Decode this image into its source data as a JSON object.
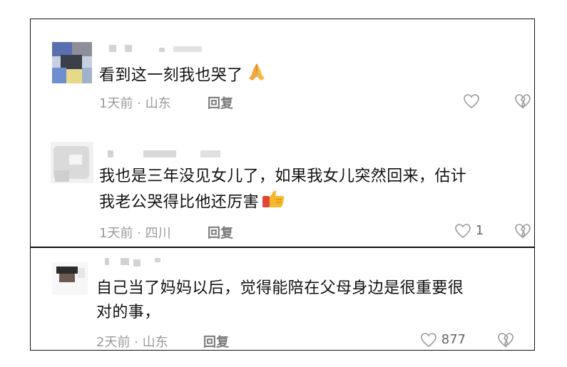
{
  "comments": [
    {
      "text": "看到这一刻我也哭了",
      "emoji": "praying-hands-icon",
      "time_location": "1天前 · 山东",
      "reply_label": "回复",
      "like_count": ""
    },
    {
      "text_line1": "我也是三年没见女儿了，如果我女儿突然回来，估计",
      "text_line2": "我老公哭得比他还厉害",
      "emoji": "thumbs-up-icon",
      "time_location": "1天前 · 四川",
      "reply_label": "回复",
      "like_count": "1"
    },
    {
      "text_line1": "自己当了妈妈以后，觉得能陪在父母身边是很重要很",
      "text_line2": "对的事，",
      "time_location": "2天前 · 山东",
      "reply_label": "回复",
      "like_count": "877"
    }
  ],
  "colors": {
    "text": "#111111",
    "meta": "#9a9a9a",
    "reply": "#7a7a7a",
    "border": "#111111"
  }
}
